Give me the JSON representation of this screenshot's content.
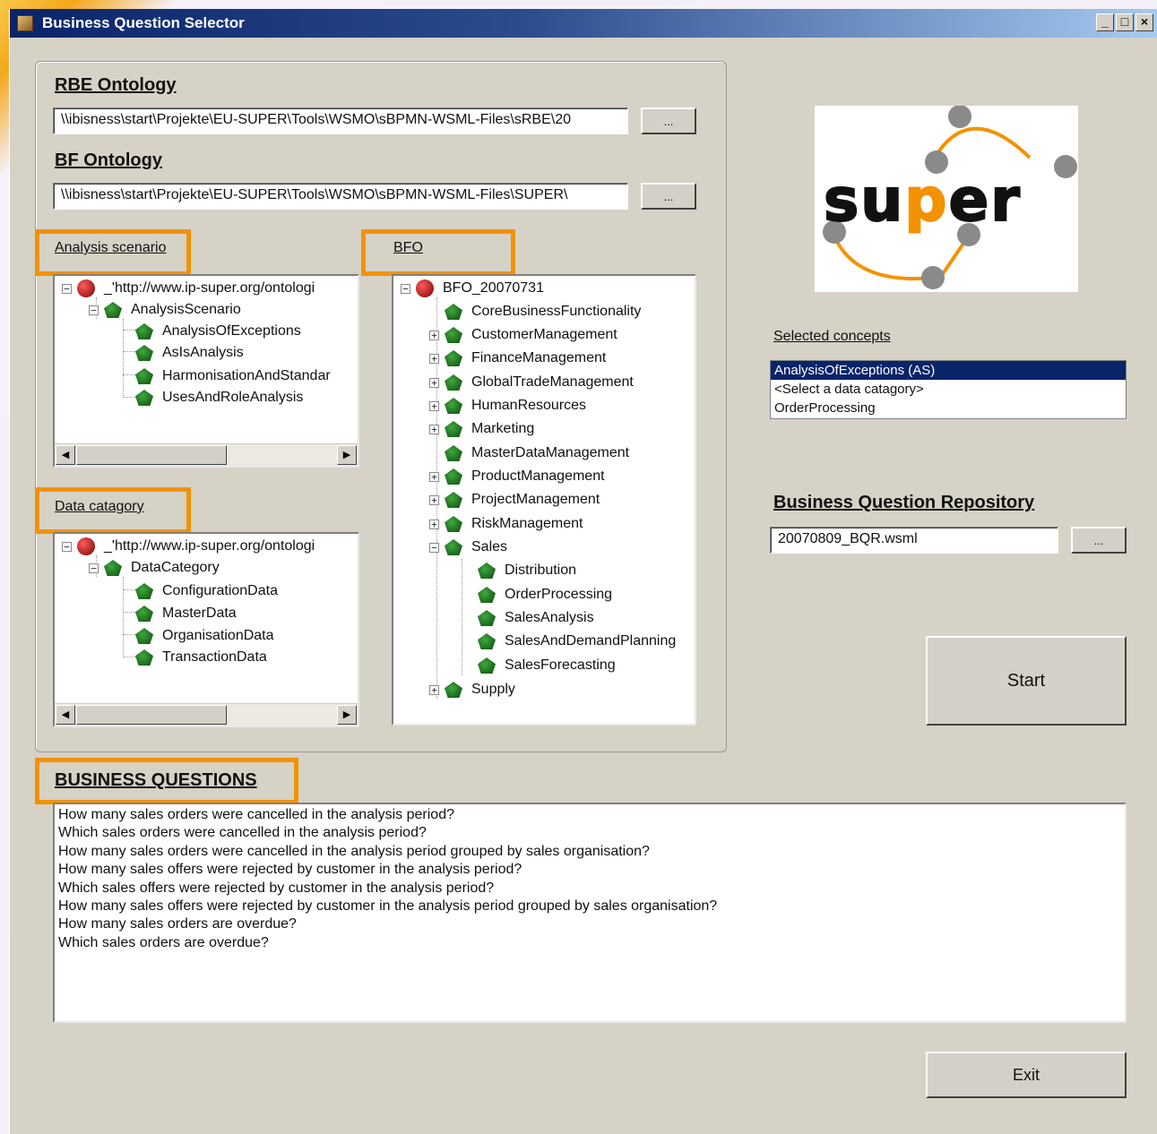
{
  "window": {
    "title": "Business Question Selector",
    "controls": [
      "_",
      "□",
      "×"
    ]
  },
  "rbe": {
    "title": "RBE Ontology",
    "path": "\\\\ibisness\\start\\Projekte\\EU-SUPER\\Tools\\WSMO\\sBPMN-WSML-Files\\sRBE\\20",
    "browse": "..."
  },
  "bf": {
    "title": "BF Ontology",
    "path": "\\\\ibisness\\start\\Projekte\\EU-SUPER\\Tools\\WSMO\\sBPMN-WSML-Files\\SUPER\\",
    "browse": "..."
  },
  "analysis": {
    "label": "Analysis scenario",
    "root": "_'http://www.ip-super.org/ontologi",
    "child": "AnalysisScenario",
    "items": [
      "AnalysisOfExceptions",
      "AsIsAnalysis",
      "HarmonisationAndStandar",
      "UsesAndRoleAnalysis"
    ]
  },
  "datacat": {
    "label": "Data catagory",
    "root": "_'http://www.ip-super.org/ontologi",
    "child": "DataCategory",
    "items": [
      "ConfigurationData",
      "MasterData",
      "OrganisationData",
      "TransactionData"
    ]
  },
  "bfo": {
    "label": "BFO",
    "root": "BFO_20070731",
    "items": [
      "CoreBusinessFunctionality",
      "CustomerManagement",
      "FinanceManagement",
      "GlobalTradeManagement",
      "HumanResources",
      "Marketing",
      "MasterDataManagement",
      "ProductManagement",
      "ProjectManagement",
      "RiskManagement",
      "Sales"
    ],
    "sales_children": [
      "Distribution",
      "OrderProcessing",
      "SalesAnalysis",
      "SalesAndDemandPlanning",
      "SalesForecasting"
    ],
    "last": "Supply"
  },
  "logo": {
    "text_left": "su",
    "text_mid": "p",
    "text_right": "er"
  },
  "concepts": {
    "label": "Selected concepts",
    "items": [
      "AnalysisOfExceptions (AS)",
      "<Select a data catagory>",
      "OrderProcessing"
    ]
  },
  "repo": {
    "title": "Business Question Repository",
    "value": "20070809_BQR.wsml",
    "browse": "..."
  },
  "buttons": {
    "start": "Start",
    "exit": "Exit"
  },
  "questions": {
    "title": "BUSINESS QUESTIONS",
    "items": [
      "How many sales orders were cancelled in the analysis period?",
      "Which sales orders were cancelled in the analysis period?",
      "How many sales orders were cancelled in the analysis period grouped by sales organisation?",
      "How many sales offers were rejected by customer in the analysis period?",
      "Which sales offers were rejected by customer in the analysis period?",
      "How many sales offers were rejected by customer in the analysis period grouped by sales organisation?",
      "How many sales orders are overdue?",
      "Which sales orders are overdue?"
    ]
  },
  "colors": {
    "highlight": "#f39200",
    "titlebar": "#0a246a",
    "node_gem": "#1a7a1a",
    "root_ball": "#b00000",
    "logo_accent": "#f39200"
  }
}
